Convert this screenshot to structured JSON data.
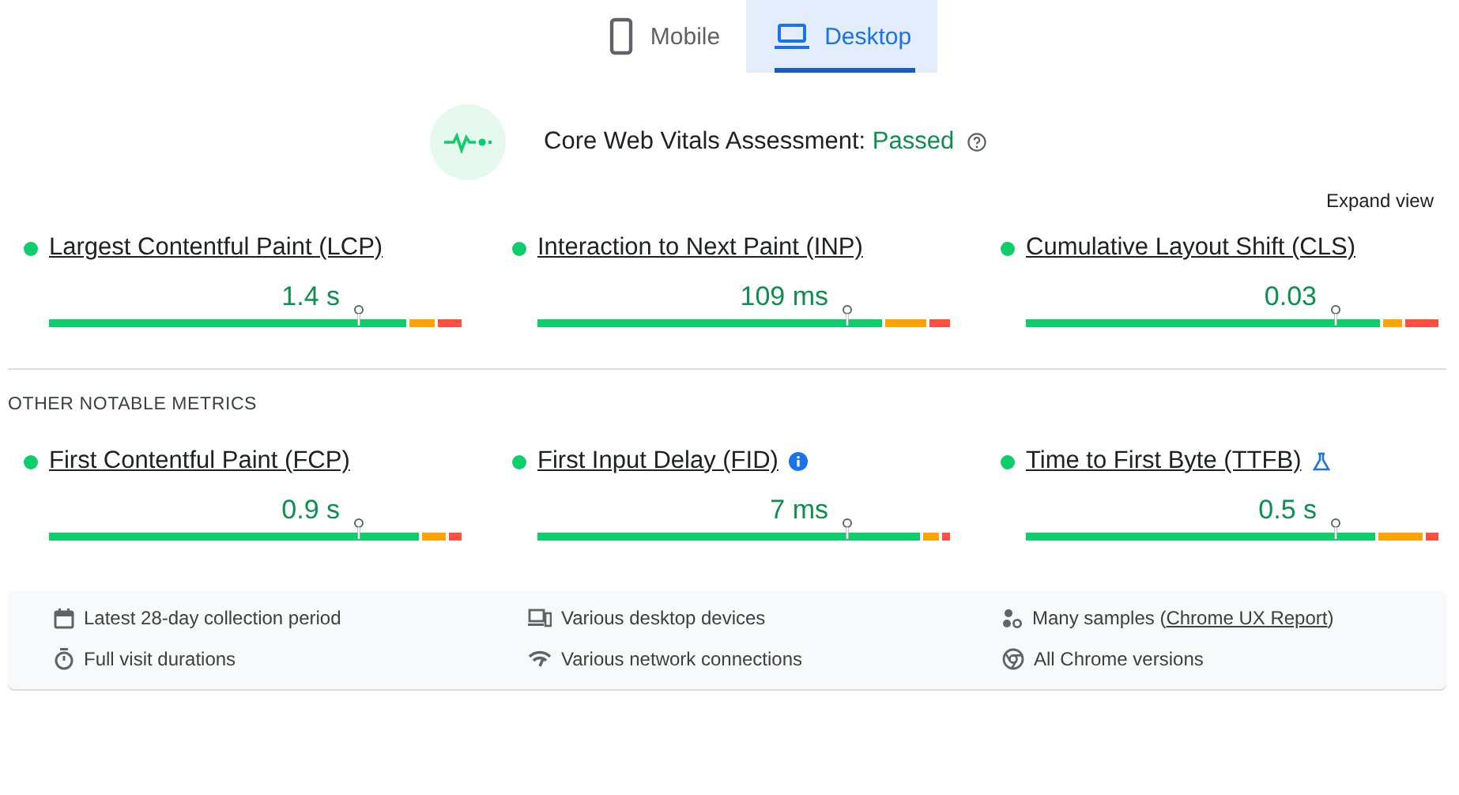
{
  "tabs": [
    {
      "label": "Mobile",
      "kind": "phone",
      "selected": false
    },
    {
      "label": "Desktop",
      "kind": "laptop",
      "selected": true
    }
  ],
  "assessment": {
    "label": "Core Web Vitals Assessment:",
    "status": "Passed"
  },
  "expand_link": "Expand view",
  "core_metrics": [
    {
      "name": "Largest Contentful Paint (LCP)",
      "value": "1.4 s",
      "color": "#0cce6b"
    },
    {
      "name": "Interaction to Next Paint (INP)",
      "value": "109 ms",
      "color": "#0cce6b"
    },
    {
      "name": "Cumulative Layout Shift (CLS)",
      "value": "0.03",
      "color": "#0cce6b"
    }
  ],
  "other_heading": "OTHER NOTABLE METRICS",
  "other_metrics": [
    {
      "name": "First Contentful Paint (FCP)",
      "value": "0.9 s",
      "color": "#0cce6b",
      "kind": "plain"
    },
    {
      "name": "First Input Delay (FID)",
      "value": "7 ms",
      "color": "#0cce6b",
      "kind": "info"
    },
    {
      "name": "Time to First Byte (TTFB)",
      "value": "0.5 s",
      "color": "#0cce6b",
      "kind": "experimental"
    }
  ],
  "footer": [
    {
      "kind": "calendar",
      "text": "Latest 28-day collection period"
    },
    {
      "kind": "devices",
      "text": "Various desktop devices"
    },
    {
      "kind": "samples",
      "text": "Many samples (",
      "link": "Chrome UX Report",
      "suffix": ")"
    },
    {
      "kind": "timer",
      "text": "Full visit durations"
    },
    {
      "kind": "network",
      "text": "Various network connections"
    },
    {
      "kind": "chrome",
      "text": "All Chrome versions"
    }
  ]
}
